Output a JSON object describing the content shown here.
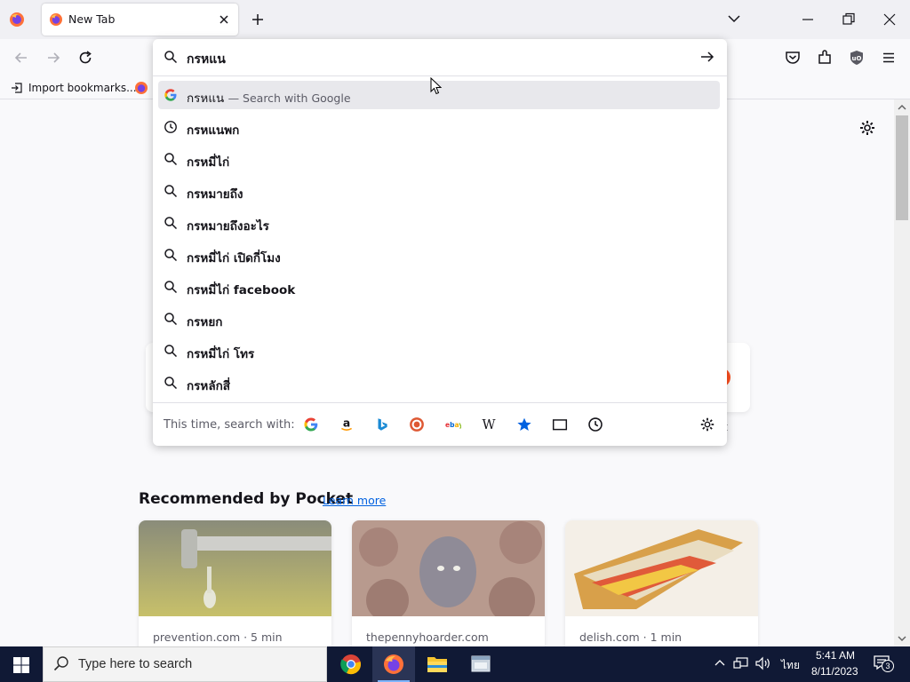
{
  "tabs": [
    {
      "title": "New Tab"
    }
  ],
  "url_input": {
    "value": "กรหแน"
  },
  "bookmarks": {
    "import_label": "Import bookmarks..."
  },
  "suggestions": [
    {
      "icon": "google-icon",
      "prefix": "กรหแน",
      "suffix": "— Search with Google",
      "active": true
    },
    {
      "icon": "history-icon",
      "text": "กรหแนพก"
    },
    {
      "icon": "search-icon",
      "text": "กรหมี่ไก่"
    },
    {
      "icon": "search-icon",
      "text": "กรหมายถึง"
    },
    {
      "icon": "search-icon",
      "text": "กรหมายถึงอะไร"
    },
    {
      "icon": "search-icon",
      "text": "กรหมี่ไก่ เปิดกี่โมง"
    },
    {
      "icon": "search-icon",
      "text": "กรหมี่ไก่ facebook"
    },
    {
      "icon": "search-icon",
      "text": "กรหยก"
    },
    {
      "icon": "search-icon",
      "text": "กรหมี่ไก่ โทร"
    },
    {
      "icon": "search-icon",
      "text": "กรหลักสี่"
    }
  ],
  "one_offs": {
    "label": "This time, search with:",
    "engines": [
      "google-icon",
      "amazon-icon",
      "bing-icon",
      "duckduckgo-icon",
      "ebay-icon",
      "wikipedia-icon",
      "bookmarks-icon",
      "tabs-icon",
      "history-icon"
    ]
  },
  "content": {
    "partial_tile_text": "t"
  },
  "pocket": {
    "heading": "Recommended by Pocket",
    "learn_more": "Learn more",
    "cards": [
      {
        "source": "prevention.com · 5 min"
      },
      {
        "source": "thepennyhoarder.com"
      },
      {
        "source": "delish.com · 1 min"
      }
    ]
  },
  "taskbar": {
    "search_placeholder": "Type here to search",
    "lang": "ไทย",
    "time": "5:41 AM",
    "date": "8/11/2023",
    "notifications": "3"
  },
  "colors": {
    "accent": "#0061e0",
    "taskbar": "#101935",
    "pocket_dot": "#ff4f1f"
  }
}
